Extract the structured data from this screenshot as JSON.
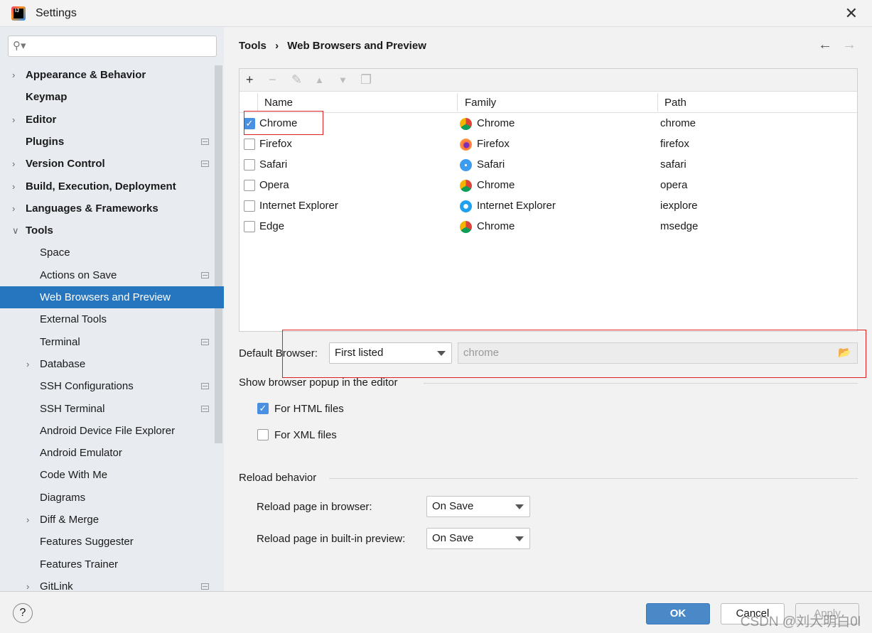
{
  "window": {
    "title": "Settings",
    "close": "✕"
  },
  "sidebar": {
    "search_placeholder": "",
    "items": [
      {
        "label": "Appearance & Behavior",
        "level": 0,
        "arrow": true
      },
      {
        "label": "Keymap",
        "level": 0
      },
      {
        "label": "Editor",
        "level": 0,
        "arrow": true
      },
      {
        "label": "Plugins",
        "level": 0,
        "badge": true
      },
      {
        "label": "Version Control",
        "level": 0,
        "arrow": true,
        "badge": true
      },
      {
        "label": "Build, Execution, Deployment",
        "level": 0,
        "arrow": true
      },
      {
        "label": "Languages & Frameworks",
        "level": 0,
        "arrow": true
      },
      {
        "label": "Tools",
        "level": 0,
        "arrow": true,
        "expanded": true
      },
      {
        "label": "Space",
        "level": 1
      },
      {
        "label": "Actions on Save",
        "level": 1,
        "badge": true
      },
      {
        "label": "Web Browsers and Preview",
        "level": 1,
        "selected": true
      },
      {
        "label": "External Tools",
        "level": 1
      },
      {
        "label": "Terminal",
        "level": 1,
        "badge": true
      },
      {
        "label": "Database",
        "level": 1,
        "arrow": true
      },
      {
        "label": "SSH Configurations",
        "level": 1,
        "badge": true
      },
      {
        "label": "SSH Terminal",
        "level": 1,
        "badge": true
      },
      {
        "label": "Android Device File Explorer",
        "level": 1
      },
      {
        "label": "Android Emulator",
        "level": 1
      },
      {
        "label": "Code With Me",
        "level": 1
      },
      {
        "label": "Diagrams",
        "level": 1
      },
      {
        "label": "Diff & Merge",
        "level": 1,
        "arrow": true
      },
      {
        "label": "Features Suggester",
        "level": 1
      },
      {
        "label": "Features Trainer",
        "level": 1
      },
      {
        "label": "GitLink",
        "level": 1,
        "arrow": true,
        "badge": true
      }
    ]
  },
  "breadcrumb": {
    "parent": "Tools",
    "sep": "›",
    "current": "Web Browsers and Preview"
  },
  "browsers": {
    "columns": [
      "Name",
      "Family",
      "Path"
    ],
    "rows": [
      {
        "checked": true,
        "name": "Chrome",
        "family": "Chrome",
        "family_icon": "chrome-icon",
        "path": "chrome"
      },
      {
        "checked": false,
        "name": "Firefox",
        "family": "Firefox",
        "family_icon": "firefox-icon",
        "path": "firefox"
      },
      {
        "checked": false,
        "name": "Safari",
        "family": "Safari",
        "family_icon": "safari-icon",
        "path": "safari"
      },
      {
        "checked": false,
        "name": "Opera",
        "family": "Chrome",
        "family_icon": "chrome-icon",
        "path": "opera"
      },
      {
        "checked": false,
        "name": "Internet Explorer",
        "family": "Internet Explorer",
        "family_icon": "ie-icon",
        "path": "iexplore"
      },
      {
        "checked": false,
        "name": "Edge",
        "family": "Chrome",
        "family_icon": "chrome-icon",
        "path": "msedge"
      }
    ]
  },
  "default_browser": {
    "label": "Default Browser:",
    "value": "First listed",
    "path": "chrome"
  },
  "popup": {
    "title": "Show browser popup in the editor",
    "html_label": "For HTML files",
    "html_checked": true,
    "xml_label": "For XML files",
    "xml_checked": false
  },
  "reload": {
    "title": "Reload behavior",
    "browser_label": "Reload page in browser:",
    "browser_value": "On Save",
    "preview_label": "Reload page in built-in preview:",
    "preview_value": "On Save"
  },
  "footer": {
    "help": "?",
    "ok": "OK",
    "cancel": "Cancel",
    "apply": "Apply"
  },
  "watermark": "CSDN @刘大明白0l",
  "colors": {
    "accent": "#2675bf",
    "ok_button": "#4a88c7",
    "highlight_box": "#e02020"
  }
}
